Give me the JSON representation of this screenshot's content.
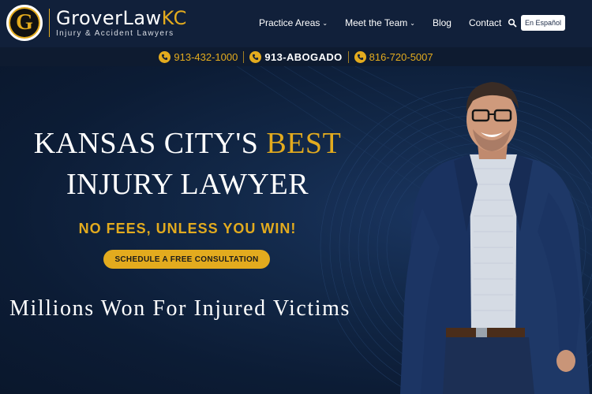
{
  "brand": {
    "logo_letter": "G",
    "name_main": "GroverLaw",
    "name_accent": "KC",
    "tagline": "Injury & Accident Lawyers"
  },
  "nav": {
    "items": [
      {
        "label": "Practice Areas",
        "has_dropdown": true
      },
      {
        "label": "Meet the Team",
        "has_dropdown": true
      },
      {
        "label": "Blog",
        "has_dropdown": false
      },
      {
        "label": "Contact",
        "has_dropdown": false
      }
    ],
    "search_icon": "search-icon",
    "language_button": "En Español"
  },
  "phones": [
    {
      "number": "913-432-1000"
    },
    {
      "number": "913-ABOGADO"
    },
    {
      "number": "816-720-5007"
    }
  ],
  "hero": {
    "line1_prefix": "KANSAS CITY'S ",
    "line1_accent": "BEST",
    "line2": "INJURY LAWYER",
    "tagline": "NO FEES, UNLESS YOU WIN!",
    "cta": "SCHEDULE A FREE CONSULTATION",
    "subheadline": "Millions Won For Injured Victims"
  },
  "colors": {
    "accent": "#e3ab1e",
    "navy": "#11203a",
    "hero_bg": "#0c1c35"
  }
}
